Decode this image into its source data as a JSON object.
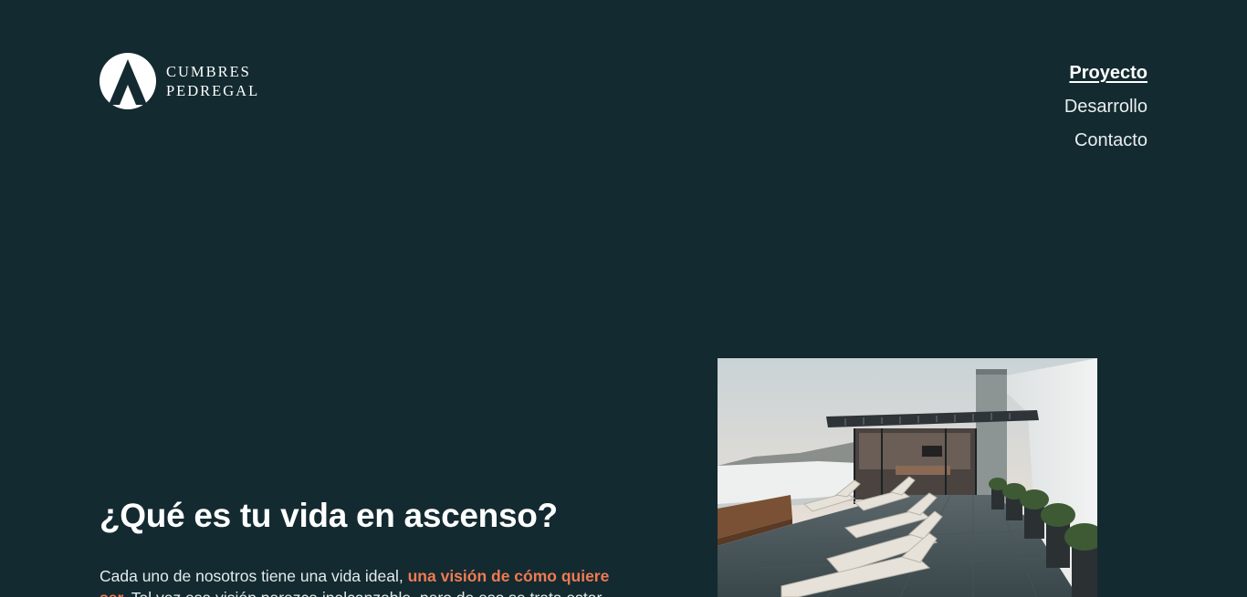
{
  "brand": {
    "line1": "CUMBRES",
    "line2": "PEDREGAL"
  },
  "nav": {
    "items": [
      {
        "label": "Proyecto",
        "active": true
      },
      {
        "label": "Desarrollo",
        "active": false
      },
      {
        "label": "Contacto",
        "active": false
      }
    ]
  },
  "intro": {
    "title": "¿Qué es tu vida en ascenso?",
    "body_start": "Cada uno de nosotros tiene una vida ideal, ",
    "body_highlight": "una visión de cómo quiere ser.",
    "body_end": " Tal vez esa visión parezca inalcanzable, pero de eso se trata estar"
  },
  "colors": {
    "background": "#132a30",
    "accent": "#f07a52",
    "text": "#ffffff"
  },
  "icons": {
    "logo": "mountain-peak-logo-icon"
  }
}
